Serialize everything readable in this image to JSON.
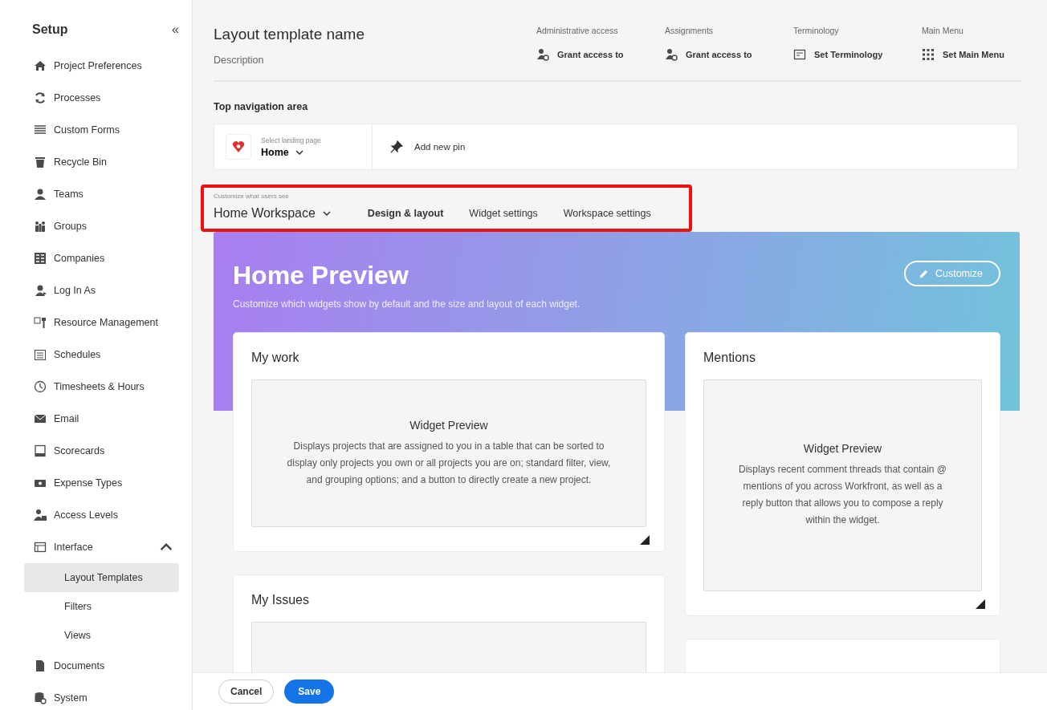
{
  "sidebar": {
    "title": "Setup",
    "collapse_icon": "«",
    "items": [
      {
        "label": "Project Preferences",
        "selected": false
      },
      {
        "label": "Processes",
        "selected": false
      },
      {
        "label": "Custom Forms",
        "selected": false
      },
      {
        "label": "Recycle Bin",
        "selected": false
      },
      {
        "label": "Teams",
        "selected": false
      },
      {
        "label": "Groups",
        "selected": false
      },
      {
        "label": "Companies",
        "selected": false
      },
      {
        "label": "Log In As",
        "selected": false
      },
      {
        "label": "Resource Management",
        "selected": false
      },
      {
        "label": "Schedules",
        "selected": false
      },
      {
        "label": "Timesheets & Hours",
        "selected": false
      },
      {
        "label": "Email",
        "selected": false
      },
      {
        "label": "Scorecards",
        "selected": false
      },
      {
        "label": "Expense Types",
        "selected": false
      },
      {
        "label": "Access Levels",
        "selected": false
      },
      {
        "label": "Interface",
        "selected": false,
        "expanded": true,
        "children": [
          {
            "label": "Layout Templates",
            "selected": true
          },
          {
            "label": "Filters",
            "selected": false
          },
          {
            "label": "Views",
            "selected": false
          }
        ]
      },
      {
        "label": "Documents",
        "selected": false
      },
      {
        "label": "System",
        "selected": false
      }
    ]
  },
  "header": {
    "title": "Layout template name",
    "description": "Description",
    "settings": [
      {
        "label": "Administrative access",
        "action": "Grant access to"
      },
      {
        "label": "Assignments",
        "action": "Grant access to"
      },
      {
        "label": "Terminology",
        "action": "Set Terminology"
      },
      {
        "label": "Main Menu",
        "action": "Set Main Menu"
      }
    ]
  },
  "top_navigation": {
    "title": "Top navigation area",
    "landing_label": "Select landing page",
    "landing_value": "Home",
    "add_pin": "Add new pin"
  },
  "customize": {
    "label": "Customize what users see",
    "workspace": "Home Workspace",
    "tabs": [
      {
        "label": "Design & layout",
        "selected": true
      },
      {
        "label": "Widget settings",
        "selected": false
      },
      {
        "label": "Workspace settings",
        "selected": false
      }
    ]
  },
  "preview": {
    "title": "Home Preview",
    "subtitle": "Customize which widgets show by default and the size and layout of each widget.",
    "customize_button": "Customize",
    "columns": [
      [
        {
          "kind": "widget",
          "title": "My work",
          "preview_title": "Widget Preview",
          "preview_text": "Displays projects that are assigned to you in a table that can be sorted to display only projects you own or all projects you are on; standard filter, view, and grouping options; and a button to directly create a new project."
        },
        {
          "kind": "clipped",
          "title": "My Issues"
        }
      ],
      [
        {
          "kind": "widget",
          "title": "Mentions",
          "preview_title": "Widget Preview",
          "preview_text": "Displays recent comment threads that contain @ mentions of you across Workfront, as well as a reply button that allows you to compose a reply within the widget."
        },
        {
          "kind": "blank"
        }
      ]
    ]
  },
  "footer": {
    "cancel": "Cancel",
    "save": "Save"
  }
}
